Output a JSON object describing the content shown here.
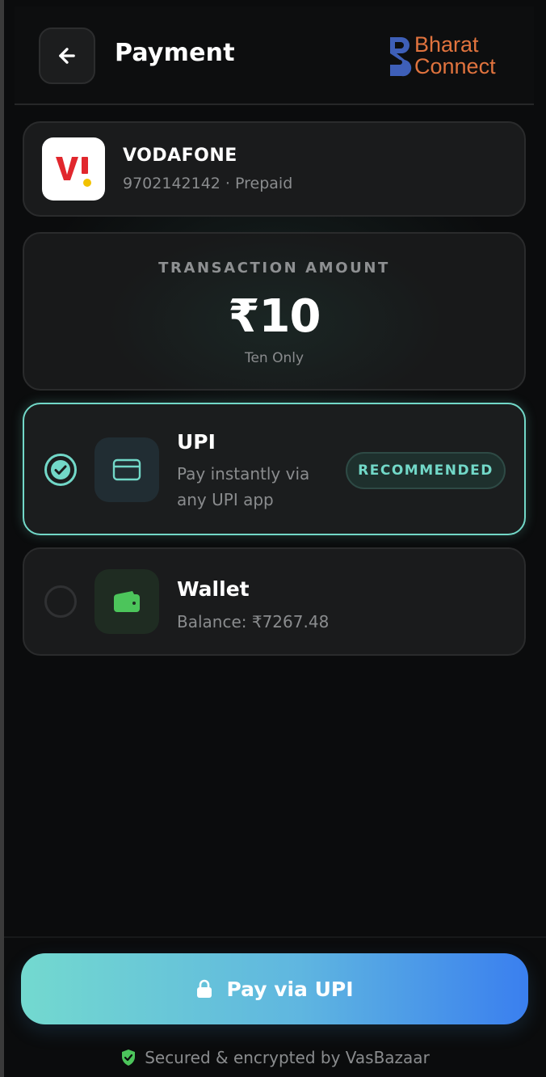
{
  "header": {
    "title": "Payment",
    "back_icon": "arrow-left-icon",
    "brand_logo": {
      "line1": "Bharat",
      "line2": "Connect",
      "color": "#e0733e",
      "mark_color": "#3e5fb8"
    }
  },
  "operator": {
    "logo": "Vi",
    "name": "VODAFONE",
    "details": "9702142142 · Prepaid"
  },
  "amount": {
    "label": "TRANSACTION AMOUNT",
    "value": "₹10",
    "words": "Ten Only"
  },
  "payment_methods": [
    {
      "id": "upi",
      "title": "UPI",
      "description": "Pay instantly via any UPI app",
      "badge": "RECOMMENDED",
      "selected": true,
      "icon": "card-icon"
    },
    {
      "id": "wallet",
      "title": "Wallet",
      "description": "Balance: ₹7267.48",
      "selected": false,
      "icon": "wallet-icon"
    }
  ],
  "pay_button": {
    "label": "Pay via UPI",
    "icon": "lock-icon"
  },
  "footer": {
    "secure_text": "Secured & encrypted by VasBazaar",
    "icon": "shield-check-icon"
  },
  "colors": {
    "accent": "#72d8c8",
    "wallet_green": "#4cc55b",
    "background": "#0b0c0d"
  }
}
